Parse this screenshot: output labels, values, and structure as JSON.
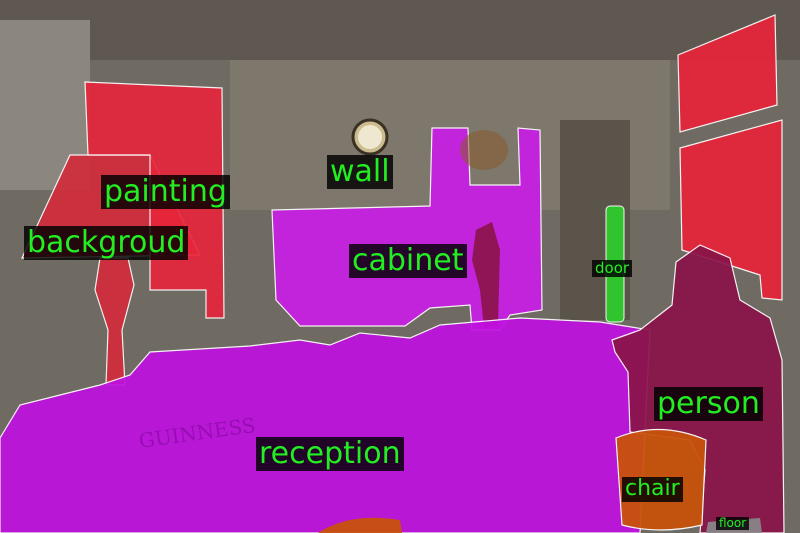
{
  "image": {
    "description_colors": {
      "background": "#6e6a62",
      "label_text": "#22ee22",
      "label_bg": "#000000"
    }
  },
  "segments": [
    {
      "label": "wall",
      "color": "#7a7670"
    },
    {
      "label": "painting",
      "color": "#e8243a"
    },
    {
      "label": "backgroud",
      "color": "#d42a3a"
    },
    {
      "label": "cabinet",
      "color": "#c81ee6"
    },
    {
      "label": "door",
      "color": "#2ecc2e"
    },
    {
      "label": "person",
      "color": "#8a1448"
    },
    {
      "label": "reception",
      "color": "#c010e0"
    },
    {
      "label": "chair",
      "color": "#c8520a"
    },
    {
      "label": "floor",
      "color": "#ffffff"
    }
  ],
  "labels": {
    "painting": "painting",
    "wall": "wall",
    "backgroud": "backgroud",
    "cabinet": "cabinet",
    "door": "door",
    "person": "person",
    "reception": "reception",
    "chair": "chair",
    "floor": "floor"
  }
}
